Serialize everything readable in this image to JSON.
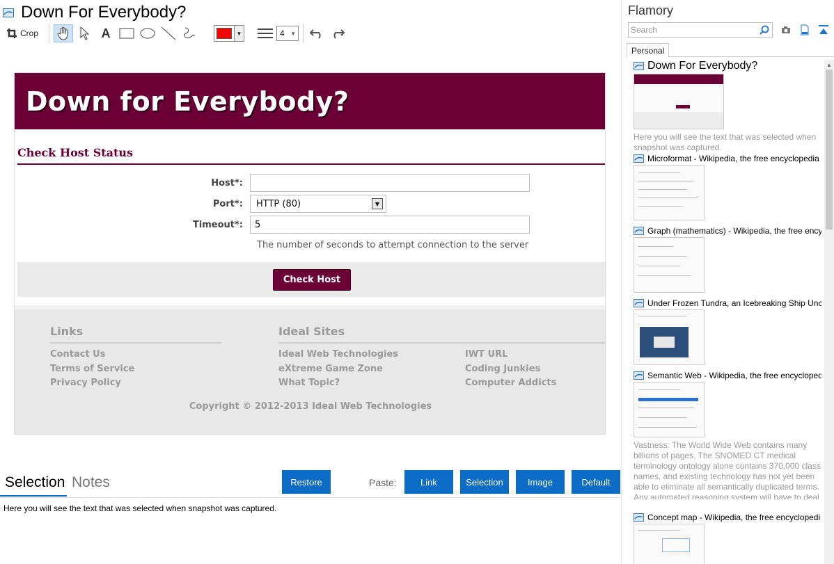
{
  "window": {
    "title": "Down For Everybody?"
  },
  "toolbar": {
    "crop_label": "Crop",
    "line_width": "4"
  },
  "colors": {
    "accent": "#0a6cc4",
    "site_primary": "#6b0036",
    "pen_color": "#ff0000"
  },
  "snapshot": {
    "banner_title": "Down for Everybody?",
    "section_title": "Check Host Status",
    "host_label": "Host*:",
    "host_value": "",
    "port_label": "Port*:",
    "port_value": "HTTP (80)",
    "timeout_label": "Timeout*:",
    "timeout_value": "5",
    "hint": "The number of seconds to attempt connection to the server",
    "check_button": "Check Host",
    "footer": {
      "links_heading": "Links",
      "links": [
        "Contact Us",
        "Terms of Service",
        "Privacy Policy"
      ],
      "ideal_heading": "Ideal Sites",
      "ideal_links": [
        "Ideal Web Technologies",
        "eXtreme Game Zone",
        "What Topic?"
      ],
      "more_links": [
        "IWT URL",
        "Coding Junkies",
        "Computer Addicts"
      ],
      "copyright": "Copyright © 2012-2013 Ideal Web Technologies"
    }
  },
  "bottom": {
    "tab_selection": "Selection",
    "tab_notes": "Notes",
    "restore": "Restore",
    "paste_label": "Paste:",
    "paste_link": "Link",
    "paste_selection": "Selection",
    "paste_image": "Image",
    "paste_default": "Default",
    "selection_text": "Here you will see the text that was selected when snapshot was captured."
  },
  "sidebar": {
    "app_name": "Flamory",
    "search_placeholder": "Search",
    "tab_personal": "Personal",
    "items": [
      {
        "title": "Down For Everybody?",
        "desc": "Here you will see the text that was selected when snapshot was captured."
      },
      {
        "title": "Microformat - Wikipedia, the free encyclopedia",
        "desc": ""
      },
      {
        "title": "Graph (mathematics) - Wikipedia, the free ency",
        "desc": ""
      },
      {
        "title": "Under Frozen Tundra, an Icebreaking Ship Unco",
        "desc": ""
      },
      {
        "title": "Semantic Web - Wikipedia, the free encycloped",
        "desc": "Vastness: The World Wide Web contains many billions of pages. The SNOMED CT medical terminology ontology alone contains 370,000 class names, and existing technology has not yet been able to eliminate all semantically duplicated terms. Any automated reasoning system will have to deal with truly huge inputs."
      },
      {
        "title": "Concept map - Wikipedia, the free encyclopedi",
        "desc": ""
      }
    ]
  }
}
